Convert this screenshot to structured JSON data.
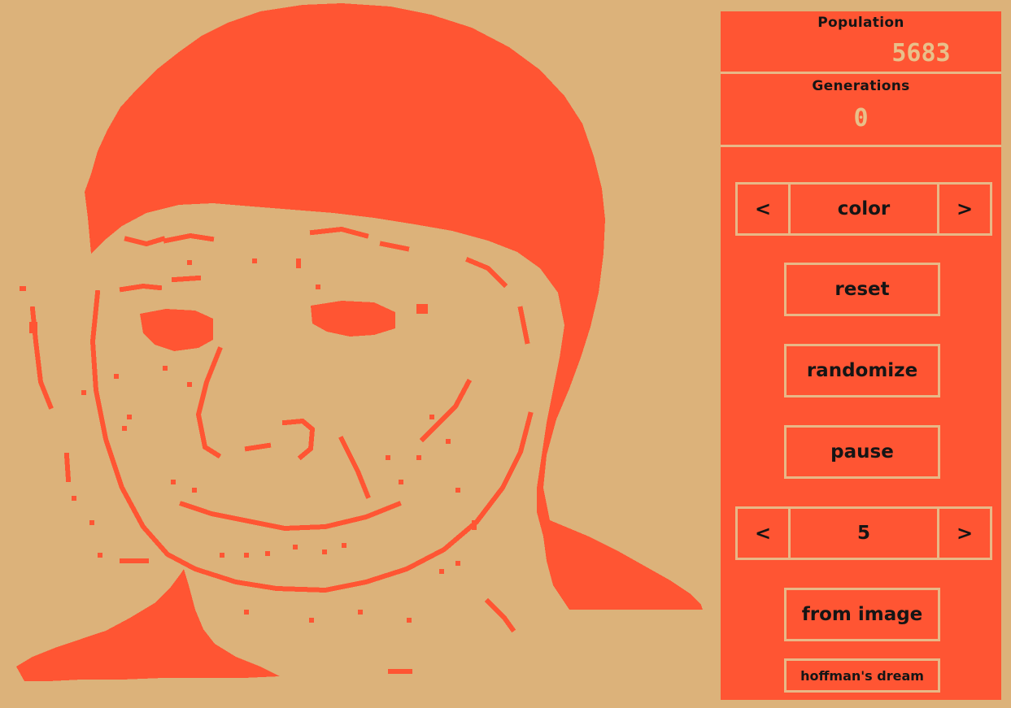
{
  "stats": {
    "population_label": "Population",
    "population_value": "5683",
    "generations_label": "Generations",
    "generations_value": "0"
  },
  "color_selector": {
    "prev": "<",
    "value": "color",
    "next": ">"
  },
  "buttons": {
    "reset": "reset",
    "randomize": "randomize",
    "pause": "pause",
    "from_image": "from image",
    "hoffman": "hoffman's dream"
  },
  "speed_selector": {
    "prev": "<",
    "value": "5",
    "next": ">"
  },
  "colors": {
    "background": "#DCB27A",
    "cell": "#FF5533",
    "border": "#E8B887",
    "text": "#151515"
  }
}
